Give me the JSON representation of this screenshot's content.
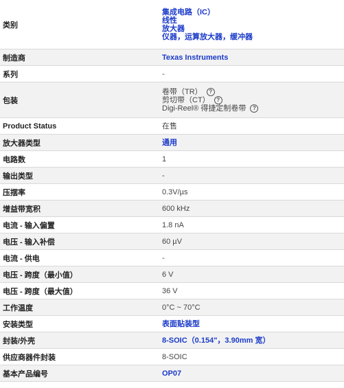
{
  "rows": [
    {
      "label": "类别",
      "values": [
        "集成电路（IC）",
        "线性",
        "放大器",
        "仪器，运算放大器，缓冲器"
      ],
      "link": true
    },
    {
      "label": "制造商",
      "values": [
        "Texas Instruments"
      ],
      "link": true
    },
    {
      "label": "系列",
      "values": [
        "-"
      ],
      "link": false
    },
    {
      "label": "包装",
      "packaging": [
        "卷带（TR）",
        "剪切带（CT）",
        "Digi-Reel® 得捷定制卷带"
      ],
      "help_icon": "question-circle-icon"
    },
    {
      "label": "Product Status",
      "values": [
        "在售"
      ],
      "link": false
    },
    {
      "label": "放大器类型",
      "values": [
        "通用"
      ],
      "link": true
    },
    {
      "label": "电路数",
      "values": [
        "1"
      ],
      "link": false
    },
    {
      "label": "输出类型",
      "values": [
        "-"
      ],
      "link": false
    },
    {
      "label": "压摆率",
      "values": [
        "0.3V/µs"
      ],
      "link": false
    },
    {
      "label": "增益带宽积",
      "values": [
        "600 kHz"
      ],
      "link": false
    },
    {
      "label": "电流 - 输入偏置",
      "values": [
        "1.8 nA"
      ],
      "link": false
    },
    {
      "label": "电压 - 输入补偿",
      "values": [
        "60 µV"
      ],
      "link": false
    },
    {
      "label": "电流 - 供电",
      "values": [
        "-"
      ],
      "link": false
    },
    {
      "label": "电压 - 跨度（最小值）",
      "values": [
        "6 V"
      ],
      "link": false
    },
    {
      "label": "电压 - 跨度（最大值）",
      "values": [
        "36 V"
      ],
      "link": false
    },
    {
      "label": "工作温度",
      "values": [
        "0°C ~ 70°C"
      ],
      "link": false
    },
    {
      "label": "安装类型",
      "values": [
        "表面贴装型"
      ],
      "link": true
    },
    {
      "label": "封装/外壳",
      "values": [
        "8-SOIC（0.154\"，3.90mm 宽）"
      ],
      "link": true
    },
    {
      "label": "供应商器件封装",
      "values": [
        "8-SOIC"
      ],
      "link": false
    },
    {
      "label": "基本产品编号",
      "values": [
        "OP07"
      ],
      "link": true
    }
  ],
  "colors": {
    "link": "#1a3ac9",
    "alt_row": "#f2f2f2",
    "border": "#d9d9d9"
  }
}
